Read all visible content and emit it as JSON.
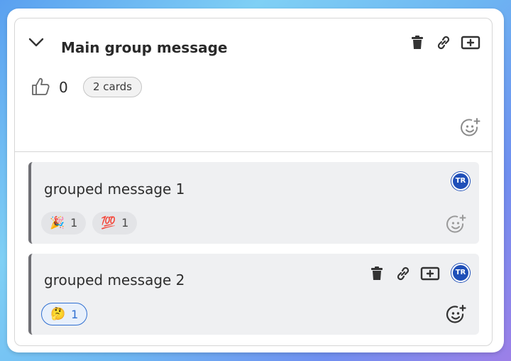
{
  "main": {
    "title": "Main group message",
    "like_count": "0",
    "cards_badge": "2 cards"
  },
  "messages": [
    {
      "text": "grouped message 1",
      "avatar": "TR",
      "reactions": [
        {
          "emoji": "🎉",
          "count": "1"
        },
        {
          "emoji": "💯",
          "count": "1"
        }
      ]
    },
    {
      "text": "grouped message 2",
      "avatar": "TR",
      "reactions": [
        {
          "emoji": "🤔",
          "count": "1"
        }
      ]
    }
  ],
  "icons": [
    "chevron-down-icon",
    "trash-icon",
    "link-icon",
    "add-card-icon",
    "thumbs-up-icon",
    "add-emoji-icon"
  ],
  "colors": {
    "avatar_bg": "#1f4fb8",
    "active_reaction_border": "#2f6fd1",
    "message_bg": "#eff0f2",
    "message_accent": "#6f6f74"
  }
}
